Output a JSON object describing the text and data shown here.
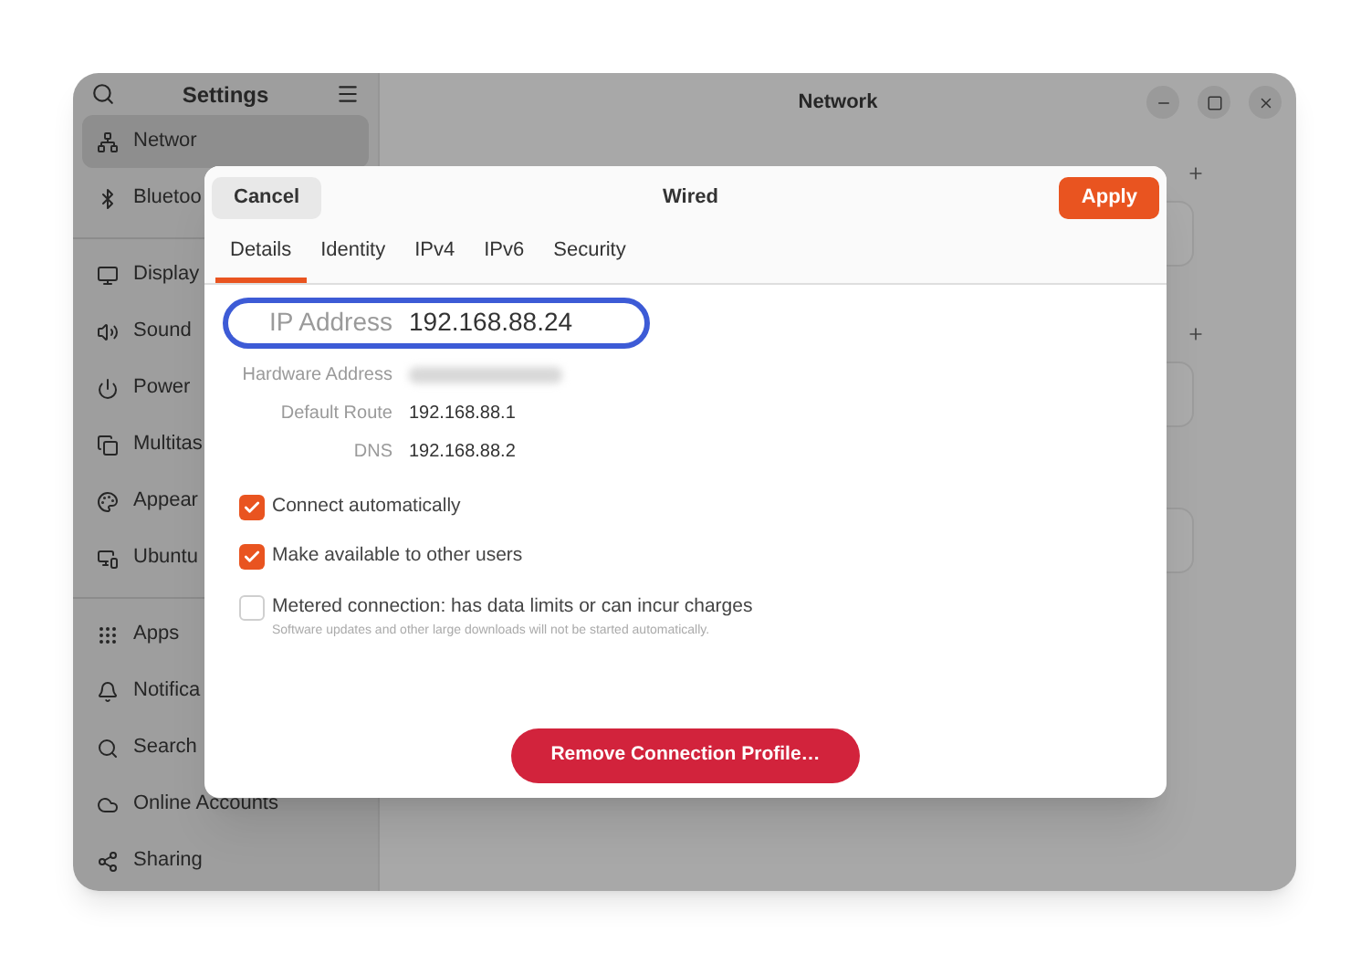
{
  "sidebar": {
    "title": "Settings",
    "items": [
      {
        "label": "Networ",
        "selected": true
      },
      {
        "label": "Bluetoo",
        "selected": false
      },
      {
        "label": "Display",
        "selected": false
      },
      {
        "label": "Sound",
        "selected": false
      },
      {
        "label": "Power",
        "selected": false
      },
      {
        "label": "Multitas",
        "selected": false
      },
      {
        "label": "Appear",
        "selected": false
      },
      {
        "label": "Ubuntu",
        "selected": false
      },
      {
        "label": "Apps",
        "selected": false
      },
      {
        "label": "Notifica",
        "selected": false
      },
      {
        "label": "Search",
        "selected": false
      },
      {
        "label": "Online Accounts",
        "selected": false
      },
      {
        "label": "Sharing",
        "selected": false
      }
    ]
  },
  "main": {
    "title": "Network"
  },
  "dialog": {
    "title": "Wired",
    "cancel": "Cancel",
    "apply": "Apply",
    "tabs": [
      {
        "label": "Details",
        "selected": true
      },
      {
        "label": "Identity",
        "selected": false
      },
      {
        "label": "IPv4",
        "selected": false
      },
      {
        "label": "IPv6",
        "selected": false
      },
      {
        "label": "Security",
        "selected": false
      }
    ],
    "details": [
      {
        "label": "IP Address",
        "value": "192.168.88.24",
        "highlighted": true
      },
      {
        "label": "Hardware Address",
        "redacted": true,
        "highlighted": false
      },
      {
        "label": "Default Route",
        "value": "192.168.88.1",
        "highlighted": false
      },
      {
        "label": "DNS",
        "value": "192.168.88.2",
        "highlighted": false
      }
    ],
    "options": [
      {
        "label": "Connect automatically",
        "checked": true
      },
      {
        "label": "Make available to other users",
        "checked": true
      },
      {
        "label": "Metered connection: has data limits or can incur charges",
        "note": "Software updates and other large downloads will not be started automatically.",
        "checked": false
      }
    ],
    "remove": "Remove Connection Profile…"
  }
}
